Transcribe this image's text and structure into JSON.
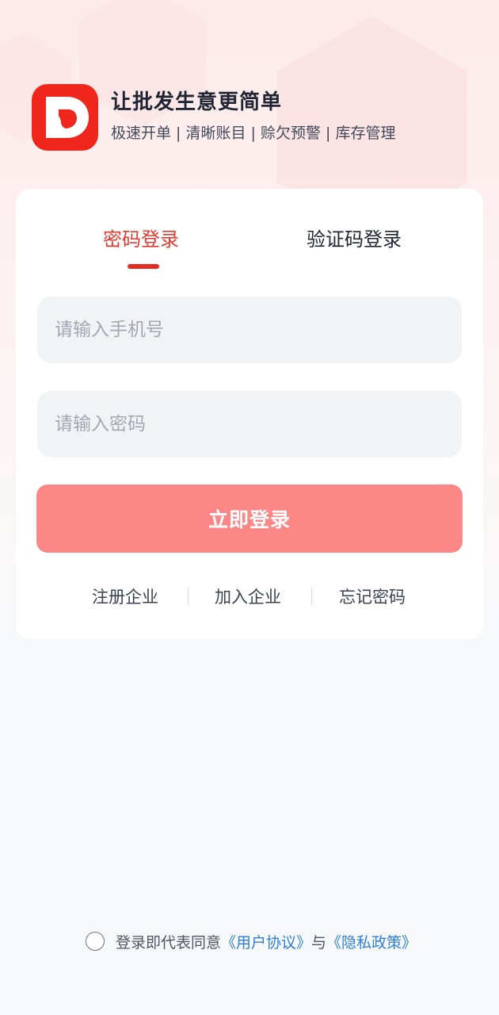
{
  "brand": {
    "logo_letter": "D",
    "slogan": "让批发生意更简单",
    "features": "极速开单 | 清晰账目 | 赊欠预警 | 库存管理"
  },
  "tabs": [
    {
      "label": "密码登录",
      "active": true
    },
    {
      "label": "验证码登录",
      "active": false
    }
  ],
  "form": {
    "phone_placeholder": "请输入手机号",
    "phone_value": "",
    "password_placeholder": "请输入密码",
    "password_value": "",
    "login_label": "立即登录"
  },
  "links": {
    "register": "注册企业",
    "join": "加入企业",
    "forgot": "忘记密码"
  },
  "agreement": {
    "checked": false,
    "prefix": "登录即代表同意",
    "user_agreement": "《用户协议》",
    "joiner": "与",
    "privacy_policy": "《隐私政策》"
  },
  "colors": {
    "brand_red": "#f0261d",
    "active_tab": "#e63a30",
    "login_button": "#fb8887",
    "link_blue": "#2f7fd6"
  }
}
